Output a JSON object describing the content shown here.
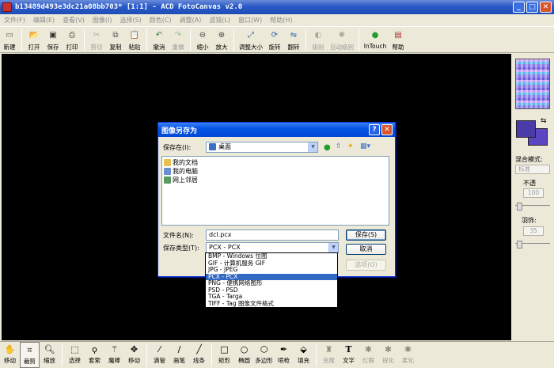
{
  "window": {
    "title": "b13489d493e3dc21a08bb703* [1:1] - ACD FotoCanvas v2.0"
  },
  "menubar": {
    "items": [
      "文件(F)",
      "编辑(E)",
      "查看(V)",
      "图像(I)",
      "选择(S)",
      "颜色(C)",
      "调整(A)",
      "滤镜(L)",
      "窗口(W)",
      "帮助(H)"
    ]
  },
  "toolbar": {
    "items": [
      {
        "label": "新建",
        "icon": "new-icon",
        "enabled": true
      },
      {
        "label": "打开",
        "icon": "open-icon",
        "enabled": true
      },
      {
        "label": "保存",
        "icon": "save-icon",
        "enabled": true
      },
      {
        "label": "打印",
        "icon": "print-icon",
        "enabled": true
      },
      {
        "label": "剪切",
        "icon": "cut-icon",
        "enabled": false
      },
      {
        "label": "复制",
        "icon": "copy-icon",
        "enabled": true
      },
      {
        "label": "粘贴",
        "icon": "paste-icon",
        "enabled": true
      },
      {
        "label": "撤消",
        "icon": "undo-icon",
        "enabled": true
      },
      {
        "label": "重做",
        "icon": "redo-icon",
        "enabled": false
      },
      {
        "label": "缩小",
        "icon": "zoom-out-icon",
        "enabled": true
      },
      {
        "label": "放大",
        "icon": "zoom-in-icon",
        "enabled": true
      },
      {
        "label": "调整大小",
        "icon": "resize-icon",
        "enabled": true
      },
      {
        "label": "旋转",
        "icon": "rotate-icon",
        "enabled": true
      },
      {
        "label": "翻转",
        "icon": "flip-icon",
        "enabled": true
      },
      {
        "label": "级别",
        "icon": "levels-icon",
        "enabled": false
      },
      {
        "label": "自动级别",
        "icon": "auto-levels-icon",
        "enabled": false
      },
      {
        "label": "InTouch",
        "icon": "intouch-icon",
        "enabled": true
      },
      {
        "label": "帮助",
        "icon": "help-icon",
        "enabled": true
      }
    ]
  },
  "right_panel": {
    "blend_label": "混合模式:",
    "blend_value": "标准",
    "opacity_label": "不透",
    "opacity_value": "100",
    "feather_label": "羽饰:",
    "feather_value": "35",
    "fg_color": "#4B3BA8",
    "bg_color": "#5B45C0"
  },
  "bottom_toolbar": {
    "items": [
      {
        "label": "移动",
        "icon": "hand-icon",
        "enabled": true,
        "selected": false
      },
      {
        "label": "裁剪",
        "icon": "crop-icon",
        "enabled": true,
        "selected": true
      },
      {
        "label": "缩放",
        "icon": "magnifier-icon",
        "enabled": true,
        "selected": false
      },
      {
        "label": "选择",
        "icon": "rect-select-icon",
        "enabled": true,
        "selected": false
      },
      {
        "label": "套索",
        "icon": "lasso-icon",
        "enabled": true,
        "selected": false
      },
      {
        "label": "魔棒",
        "icon": "magic-wand-icon",
        "enabled": true,
        "selected": false
      },
      {
        "label": "移动",
        "icon": "move-arrows-icon",
        "enabled": true,
        "selected": false
      },
      {
        "label": "滴管",
        "icon": "eyedropper-icon",
        "enabled": true,
        "selected": false
      },
      {
        "label": "画笔",
        "icon": "brush-icon",
        "enabled": true,
        "selected": false
      },
      {
        "label": "线条",
        "icon": "line-icon",
        "enabled": true,
        "selected": false
      },
      {
        "label": "矩形",
        "icon": "rectangle-icon",
        "enabled": true,
        "selected": false
      },
      {
        "label": "椭圆",
        "icon": "ellipse-icon",
        "enabled": true,
        "selected": false
      },
      {
        "label": "多边形",
        "icon": "polygon-icon",
        "enabled": true,
        "selected": false
      },
      {
        "label": "喷枪",
        "icon": "airbrush-icon",
        "enabled": true,
        "selected": false
      },
      {
        "label": "填充",
        "icon": "fill-icon",
        "enabled": true,
        "selected": false
      },
      {
        "label": "克隆",
        "icon": "clone-icon",
        "enabled": false,
        "selected": false
      },
      {
        "label": "文字",
        "icon": "text-icon",
        "enabled": true,
        "selected": false
      },
      {
        "label": "红眼",
        "icon": "redeye-icon",
        "enabled": false,
        "selected": false
      },
      {
        "label": "锐化",
        "icon": "sharpen-icon",
        "enabled": false,
        "selected": false
      },
      {
        "label": "柔化",
        "icon": "soften-icon",
        "enabled": false,
        "selected": false
      }
    ]
  },
  "dialog": {
    "title": "图像另存为",
    "save_in_label": "保存在(I):",
    "save_in_value": "桌面",
    "files": [
      {
        "name": "我的文档",
        "icon": "folder-icon"
      },
      {
        "name": "我的电脑",
        "icon": "computer-icon"
      },
      {
        "name": "网上邻居",
        "icon": "network-icon"
      }
    ],
    "filename_label": "文件名(N):",
    "filename_value": "dcl.pcx",
    "filetype_label": "保存类型(T):",
    "filetype_value": "PCX - PCX",
    "save_button": "保存(S)",
    "cancel_button": "取消",
    "options_button": "选项(O)",
    "filetype_options": [
      "BMP - Windows 位图",
      "GIF - 计算机服务 GIF",
      "JPG - JPEG",
      "PCX - PCX",
      "PNG - 便携网络图形",
      "PSD - PSD",
      "TGA - Targa",
      "TIFF - Tag 图像文件格式"
    ],
    "selected_option_index": 3
  }
}
